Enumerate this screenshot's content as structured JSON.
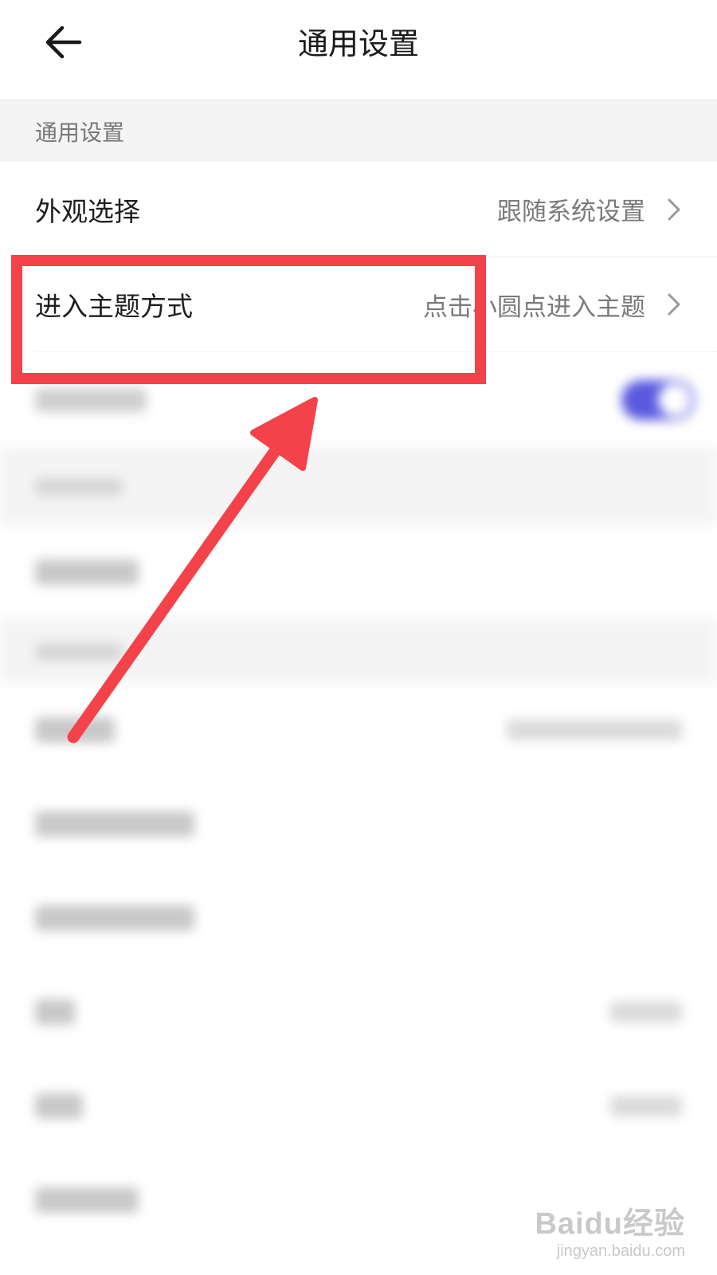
{
  "header": {
    "title": "通用设置",
    "back_icon": "arrow-left-icon"
  },
  "section_general": {
    "title": "通用设置"
  },
  "rows": [
    {
      "label": "外观选择",
      "value": "跟随系统设置"
    },
    {
      "label": "进入主题方式",
      "value": "点击小圆点进入主题"
    }
  ],
  "annotation": {
    "color": "#f4424a"
  },
  "watermark": {
    "main": "Baidu经验",
    "sub": "jingyan.baidu.com"
  },
  "colors": {
    "toggle_on": "#5a59e0",
    "section_bg": "#f4f4f4"
  }
}
